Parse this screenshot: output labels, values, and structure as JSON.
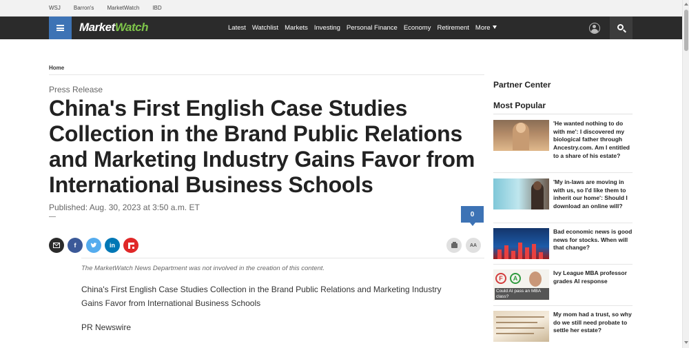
{
  "topbar": {
    "links": [
      "WSJ",
      "Barron's",
      "MarketWatch",
      "IBD"
    ]
  },
  "nav": {
    "logo_market": "Market",
    "logo_watch": "Watch",
    "links": [
      "Latest",
      "Watchlist",
      "Markets",
      "Investing",
      "Personal Finance",
      "Economy",
      "Retirement",
      "More"
    ],
    "accent": "#3d73b5",
    "bg": "#2b2b2b"
  },
  "article": {
    "breadcrumb": "Home",
    "kicker": "Press Release",
    "headline": "China's First English Case Studies Collection in the Brand Public Relations and Marketing Industry Gains Favor from International Business Schools",
    "published": "Published: Aug. 30, 2023 at 3:50 a.m. ET",
    "comment_count": "0",
    "disclaimer": "The MarketWatch News Department was not involved in the creation of this content.",
    "body_paragraph_1": "China's First English Case Studies Collection in the Brand Public Relations and Marketing Industry Gains Favor from International Business Schools",
    "body_paragraph_2": "PR Newswire"
  },
  "share": {
    "facebook_glyph": "f",
    "linkedin_glyph": "in",
    "text_size_glyph": "AA"
  },
  "sidebar": {
    "partner_center": "Partner Center",
    "most_popular": "Most Popular",
    "stories": [
      "'He wanted nothing to do with me': I discovered my biological father through Ancestry.com. Am I entitled to a share of his estate?",
      "'My in-laws are moving in with us, so I'd like them to inherit our home': Should I download an online will?",
      "Bad economic news is good news for stocks. When will that change?",
      "Ivy League MBA professor grades AI response",
      "My mom had a trust, so why do we still need probate to settle her estate?"
    ],
    "thumb4_caption": "Could AI pass an MBA class?"
  }
}
